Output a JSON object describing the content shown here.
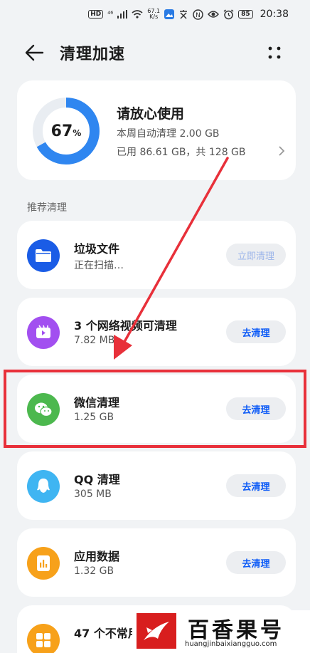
{
  "status_bar": {
    "hd": "HD",
    "signal": "⁴⁶",
    "speed_value": "67.1",
    "speed_unit": "K/s",
    "nfc": "N",
    "battery": "85",
    "time": "20:38"
  },
  "header": {
    "title": "清理加速"
  },
  "storage": {
    "percent": 67,
    "percent_text": "67",
    "percent_unit": "%",
    "title": "请放心使用",
    "auto_clean": "本周自动清理 2.00 GB",
    "used": "已用 86.61 GB，共 128 GB"
  },
  "section_label": "推荐清理",
  "items": [
    {
      "name": "垃圾文件",
      "sub": "正在扫描…",
      "button": "立即清理",
      "icon": "folder-icon",
      "color": "#1a5ce6"
    },
    {
      "name": "3 个网络视频可清理",
      "sub": "7.82 MB",
      "button": "去清理",
      "icon": "video-icon",
      "color": "#a24ff0"
    },
    {
      "name": "微信清理",
      "sub": "1.25 GB",
      "button": "去清理",
      "icon": "wechat-icon",
      "color": "#4cb84e"
    },
    {
      "name": "QQ 清理",
      "sub": "305 MB",
      "button": "去清理",
      "icon": "qq-icon",
      "color": "#3fb5f2"
    },
    {
      "name": "应用数据",
      "sub": "1.32 GB",
      "button": "去清理",
      "icon": "app-data-icon",
      "color": "#f7a11a"
    },
    {
      "name": "47 个不常用",
      "sub": "",
      "button": "",
      "icon": "apps-grid-icon",
      "color": "#f7a11a"
    }
  ],
  "watermark": {
    "name": "百香果号",
    "url": "huangjinbaixiangguo.com"
  },
  "colors": {
    "accent": "#0a59f7",
    "ring": "#2f86f0",
    "ring_track": "#e9edf2",
    "highlight": "#e8303a",
    "arrow": "#e8303a"
  }
}
